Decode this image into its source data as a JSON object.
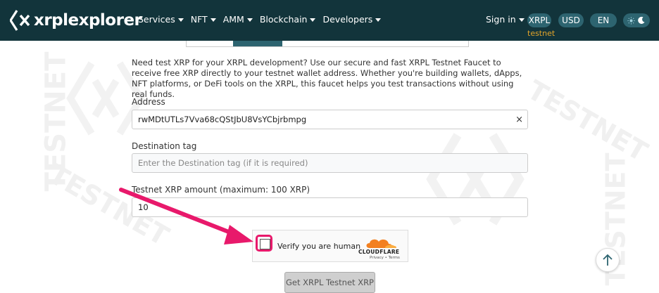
{
  "header": {
    "logo_text": "xrplexplorer",
    "nav": [
      {
        "label": "Services"
      },
      {
        "label": "NFT"
      },
      {
        "label": "AMM"
      },
      {
        "label": "Blockchain"
      },
      {
        "label": "Developers"
      }
    ],
    "signin_label": "Sign in",
    "ledger_pill": "XRPL",
    "currency_pill": "USD",
    "language_pill": "EN",
    "network_label": "testnet"
  },
  "watermark_text": "TESTNET",
  "faucet": {
    "description": "Need test XRP for your XRPL development? Use our secure and fast XRPL Testnet Faucet to receive free XRP directly to your testnet wallet address. Whether you're building wallets, dApps, NFT platforms, or DeFi tools on the XRPL, this faucet helps you test transactions without using real funds.",
    "address_label": "Address",
    "address_value": "rwMDtUTLs7Vva68cQStJbU8VsYCbjrbmpg",
    "clear_symbol": "×",
    "destination_tag_label": "Destination tag",
    "destination_tag_placeholder": "Enter the Destination tag (if it is required)",
    "amount_label": "Testnet XRP amount (maximum: 100 XRP)",
    "amount_value": "10",
    "captcha_label": "Verify you are human",
    "captcha_brand": "CLOUDFLARE",
    "captcha_links": "Privacy • Terms",
    "submit_label": "Get XRPL Testnet XRP"
  },
  "colors": {
    "header_bg": "#12343b",
    "pill_bg": "#2d6470",
    "network_text": "#e2a42a",
    "highlight": "#e8196b",
    "cloudflare_orange": "#f38020"
  }
}
